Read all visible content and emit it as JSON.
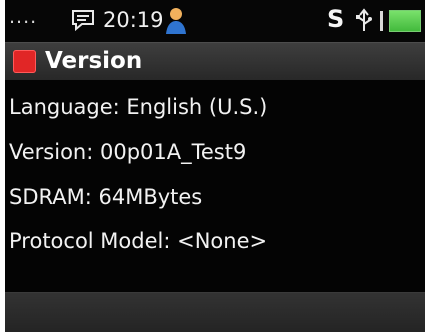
{
  "status_bar": {
    "dots": "....",
    "time": "20:19",
    "sync_label": "S",
    "icons": {
      "message": "message-icon",
      "person": "person-icon",
      "usb": "usb-icon",
      "signal": "signal-icon",
      "battery": "battery-icon"
    }
  },
  "title_bar": {
    "title": "Version",
    "icon": "version-icon",
    "icon_color": "#e12626"
  },
  "version_info": {
    "items": [
      {
        "label": "Language: English (U.S.)"
      },
      {
        "label": "Version: 00p01A_Test9"
      },
      {
        "label": "SDRAM: 64MBytes"
      },
      {
        "label": "Protocol Model: <None>"
      }
    ]
  },
  "bottom_bar": {
    "visible_text": ""
  },
  "colors": {
    "screen_background": "#050505",
    "text": "#f2f2f2",
    "battery": "#43ba3d"
  }
}
